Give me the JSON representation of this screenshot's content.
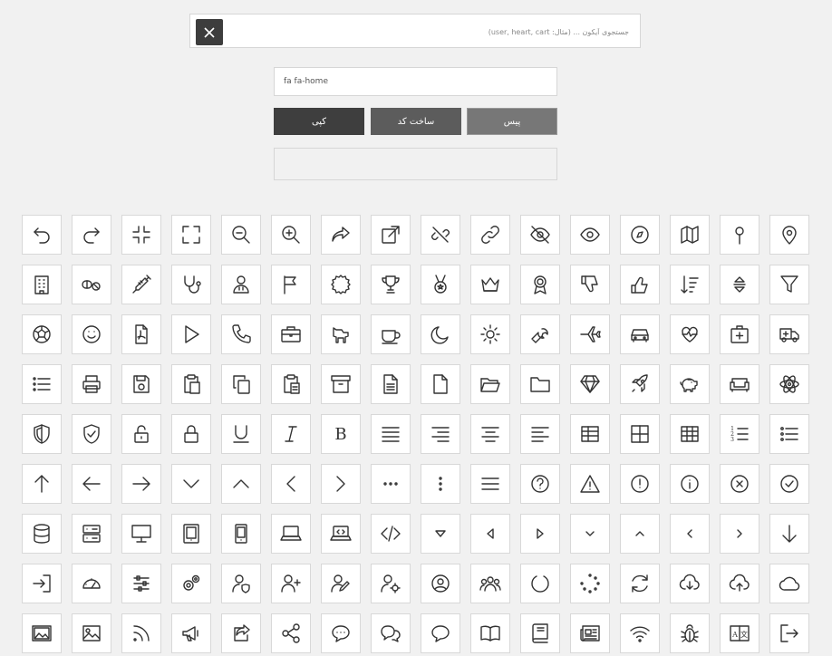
{
  "search": {
    "placeholder": "جستجوی آیکون ... (مثال: user, heart, cart)",
    "value": ""
  },
  "class_field": {
    "value": "fa fa-home"
  },
  "buttons": {
    "copy_label": "کپی",
    "generate_label": "ساخت کد",
    "paste_label": "پیس"
  },
  "output": {
    "value": ""
  },
  "icons": [
    "undo-icon",
    "redo-icon",
    "compress-icon",
    "expand-icon",
    "zoom-out-icon",
    "zoom-in-icon",
    "share-icon",
    "external-link-icon",
    "unlink-icon",
    "link-icon",
    "eye-slash-icon",
    "eye-icon",
    "compass-icon",
    "map-icon",
    "map-pin-icon",
    "map-marker-icon",
    "building-icon",
    "pills-icon",
    "syringe-icon",
    "stethoscope-icon",
    "user-doctor-icon",
    "flag-icon",
    "certificate-icon",
    "trophy-icon",
    "medal-icon",
    "crown-icon",
    "award-icon",
    "thumbs-down-icon",
    "thumbs-up-icon",
    "sort-amount-down-icon",
    "sort-icon",
    "filter-icon",
    "futbol-icon",
    "smile-icon",
    "file-pdf-icon",
    "play-icon",
    "phone-icon",
    "briefcase-icon",
    "dog-icon",
    "mug-icon",
    "moon-icon",
    "sun-icon",
    "wrench-icon",
    "plane-icon",
    "car-icon",
    "heartbeat-icon",
    "first-aid-icon",
    "ambulance-icon",
    "list-icon",
    "print-icon",
    "save-icon",
    "paste-icon",
    "copy-icon",
    "clipboard-icon",
    "archive-icon",
    "file-alt-icon",
    "file-icon",
    "folder-open-icon",
    "folder-icon",
    "gem-icon",
    "rocket-icon",
    "piggy-bank-icon",
    "couch-icon",
    "atom-icon",
    "shield-half-icon",
    "shield-check-icon",
    "unlock-icon",
    "lock-icon",
    "underline-icon",
    "italic-icon",
    "bold-icon",
    "align-justify-icon",
    "align-right-icon",
    "align-center-icon",
    "align-left-icon",
    "table-icon",
    "border-all-icon",
    "th-icon",
    "list-ol-icon",
    "list-ul-icon",
    "arrow-up-icon",
    "arrow-left-icon",
    "arrow-right-icon",
    "chevron-down-icon",
    "chevron-up-icon",
    "chevron-left-icon",
    "chevron-right-icon",
    "ellipsis-h-icon",
    "ellipsis-v-icon",
    "bars-icon",
    "question-circle-icon",
    "exclamation-triangle-icon",
    "exclamation-circle-icon",
    "info-circle-icon",
    "times-circle-icon",
    "check-circle-icon",
    "database-icon",
    "server-icon",
    "desktop-icon",
    "tablet-icon",
    "mobile-icon",
    "laptop-icon",
    "laptop-code-icon",
    "code-icon",
    "caret-down-icon",
    "caret-left-icon",
    "caret-right-icon",
    "angle-down-icon",
    "angle-up-icon",
    "angle-left-icon",
    "angle-right-icon",
    "arrow-down-icon",
    "sign-in-icon",
    "tachometer-icon",
    "sliders-icon",
    "cogs-icon",
    "user-shield-icon",
    "user-plus-icon",
    "user-edit-icon",
    "user-cog-icon",
    "user-circle-icon",
    "users-icon",
    "circle-notch-icon",
    "spinner-icon",
    "sync-icon",
    "cloud-download-icon",
    "cloud-upload-icon",
    "cloud-icon",
    "photo-video-icon",
    "image-icon",
    "rss-icon",
    "bullhorn-icon",
    "share-square-icon",
    "share-alt-icon",
    "comment-dots-icon",
    "comments-icon",
    "comment-icon",
    "book-open-icon",
    "book-icon",
    "newspaper-icon",
    "wifi-icon",
    "bug-icon",
    "language-icon",
    "sign-out-icon"
  ]
}
